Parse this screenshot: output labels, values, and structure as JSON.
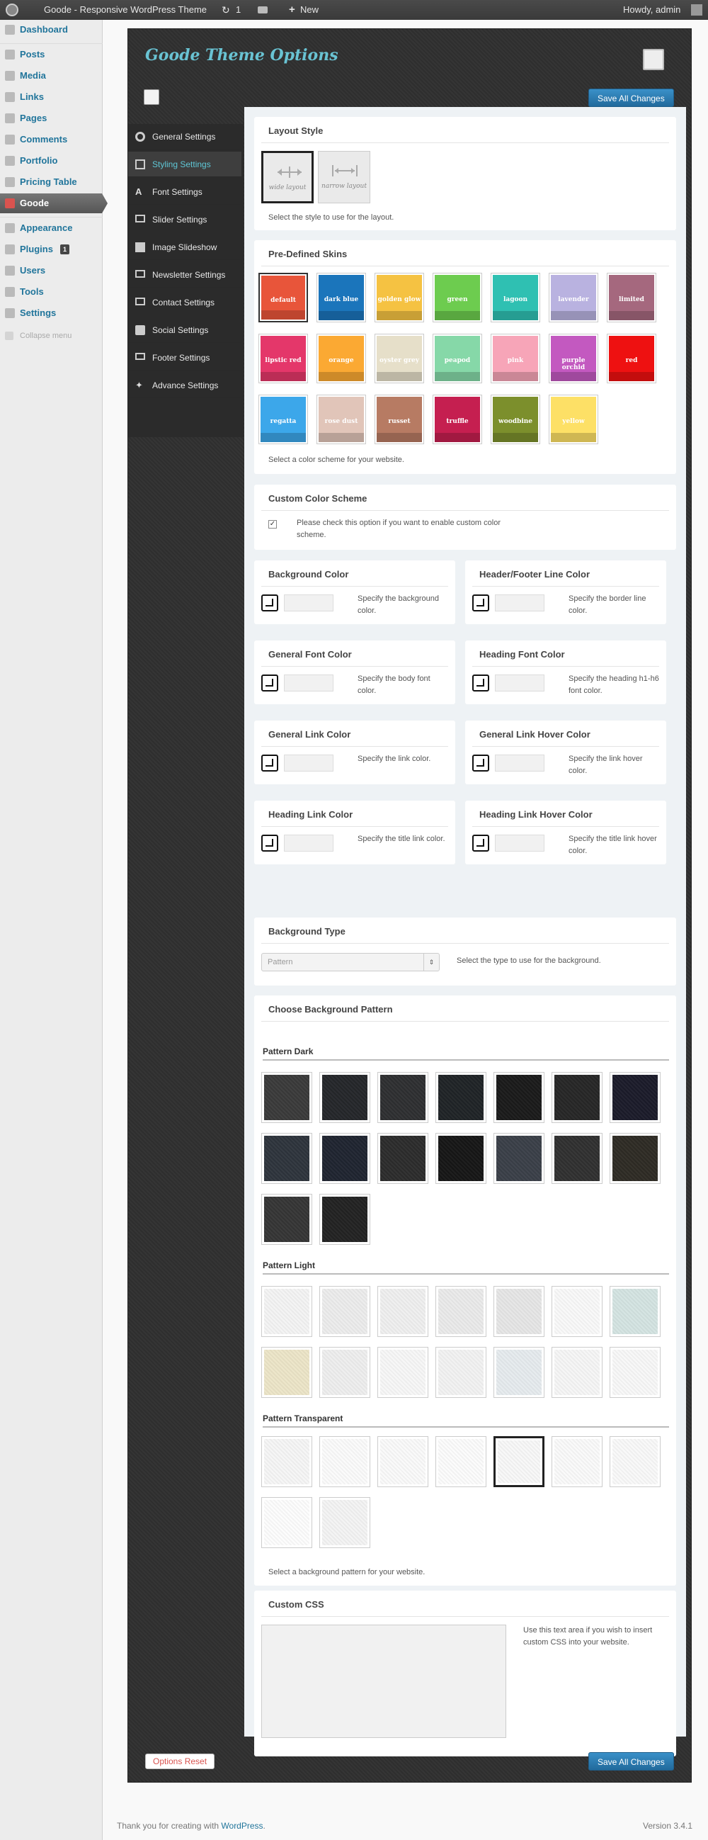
{
  "adminbar": {
    "site_name": "Goode - Responsive WordPress Theme",
    "updates": "1",
    "new_label": "New",
    "howdy": "Howdy, admin"
  },
  "menu": [
    {
      "label": "Dashboard"
    },
    {
      "label": "Posts"
    },
    {
      "label": "Media"
    },
    {
      "label": "Links"
    },
    {
      "label": "Pages"
    },
    {
      "label": "Comments"
    },
    {
      "label": "Portfolio"
    },
    {
      "label": "Pricing Table"
    },
    {
      "label": "Goode"
    },
    {
      "label": "Appearance"
    },
    {
      "label": "Plugins",
      "badge": "1"
    },
    {
      "label": "Users"
    },
    {
      "label": "Tools"
    },
    {
      "label": "Settings"
    },
    {
      "label": "Collapse menu"
    }
  ],
  "panel": {
    "title": "Goode Theme Options",
    "save_label": "Save All Changes",
    "reset_label": "Options Reset",
    "tabs": [
      {
        "label": "General Settings"
      },
      {
        "label": "Styling Settings"
      },
      {
        "label": "Font Settings"
      },
      {
        "label": "Slider Settings"
      },
      {
        "label": "Image Slideshow"
      },
      {
        "label": "Newsletter Settings"
      },
      {
        "label": "Contact Settings"
      },
      {
        "label": "Social Settings"
      },
      {
        "label": "Footer Settings"
      },
      {
        "label": "Advance Settings"
      }
    ]
  },
  "layout": {
    "title": "Layout Style",
    "wide": "wide layout",
    "narrow": "narrow layout",
    "desc": "Select the style to use for the layout."
  },
  "skins": {
    "title": "Pre-Defined Skins",
    "desc": "Select a color scheme for your website.",
    "items": [
      {
        "label": "default",
        "color": "#e8553a"
      },
      {
        "label": "dark blue",
        "color": "#1b75bb"
      },
      {
        "label": "golden glow",
        "color": "#f5c242"
      },
      {
        "label": "green",
        "color": "#6dcc4f"
      },
      {
        "label": "lagoon",
        "color": "#2fc0b2"
      },
      {
        "label": "lavender",
        "color": "#b9b2e0"
      },
      {
        "label": "limited",
        "color": "#a5687e"
      },
      {
        "label": "lipstic red",
        "color": "#e4376a"
      },
      {
        "label": "orange",
        "color": "#fba933"
      },
      {
        "label": "oyster grey",
        "color": "#e6dfc9"
      },
      {
        "label": "peapod",
        "color": "#86d8a8"
      },
      {
        "label": "pink",
        "color": "#f7a5b8"
      },
      {
        "label": "purple orchid",
        "color": "#c359c0"
      },
      {
        "label": "red",
        "color": "#ee1111"
      },
      {
        "label": "regatta",
        "color": "#3ca7ea"
      },
      {
        "label": "rose dust",
        "color": "#e1c5b9"
      },
      {
        "label": "russet",
        "color": "#b77b63"
      },
      {
        "label": "truffle",
        "color": "#c51f50"
      },
      {
        "label": "woodbine",
        "color": "#7c8f2c"
      },
      {
        "label": "yellow",
        "color": "#fde066"
      }
    ]
  },
  "custom_scheme": {
    "title": "Custom Color Scheme",
    "desc": "Please check this option if you want to enable custom color scheme."
  },
  "colors": [
    {
      "title": "Background Color",
      "desc": "Specify the background color."
    },
    {
      "title": "Header/Footer Line Color",
      "desc": "Specify the border line color."
    },
    {
      "title": "General Font Color",
      "desc": "Specify the body font color."
    },
    {
      "title": "Heading Font Color",
      "desc": "Specify the heading h1-h6 font color."
    },
    {
      "title": "General Link Color",
      "desc": "Specify the link color."
    },
    {
      "title": "General Link Hover Color",
      "desc": "Specify the link hover color."
    },
    {
      "title": "Heading Link Color",
      "desc": "Specify the title link color."
    },
    {
      "title": "Heading Link Hover Color",
      "desc": "Specify the title link hover color."
    }
  ],
  "bg_type": {
    "title": "Background Type",
    "value": "Pattern",
    "desc": "Select the type to use for the background."
  },
  "bg_pattern": {
    "title": "Choose Background Pattern",
    "dark_label": "Pattern Dark",
    "light_label": "Pattern Light",
    "transparent_label": "Pattern Transparent",
    "desc": "Select a background pattern for your website.",
    "dark": [
      "#3a3a3a",
      "#24262a",
      "#2e2f31",
      "#1f2326",
      "#1a1a1a",
      "#262626",
      "#1b1b2a",
      "#2e343c",
      "#1f2430",
      "#2c2c2c",
      "#161616",
      "#3a3f48",
      "#303030",
      "#2e2b24",
      "#353535",
      "#222222"
    ],
    "light": [
      "#f4f4f4",
      "#ececec",
      "#efefef",
      "#eaeaea",
      "#e6e6e6",
      "#f9f9f9",
      "#d4e4e2",
      "#ece5c8",
      "#eeeeee",
      "#f7f7f7",
      "#f2f2f2",
      "#e6ebee",
      "#f6f6f6",
      "#f8f8f8"
    ],
    "transparent": [
      "#f6f6f6",
      "#fbfbfb",
      "#fafafa",
      "#fcfcfc",
      "#f8f8f8",
      "#fafafa",
      "#f9f9f9",
      "#fdfdfd",
      "#f4f4f4"
    ]
  },
  "custom_css": {
    "title": "Custom CSS",
    "desc": "Use this text area if you wish to insert custom CSS into your website."
  },
  "footer": {
    "thanks": "Thank you for creating with ",
    "link": "WordPress",
    "version": "Version 3.4.1"
  }
}
